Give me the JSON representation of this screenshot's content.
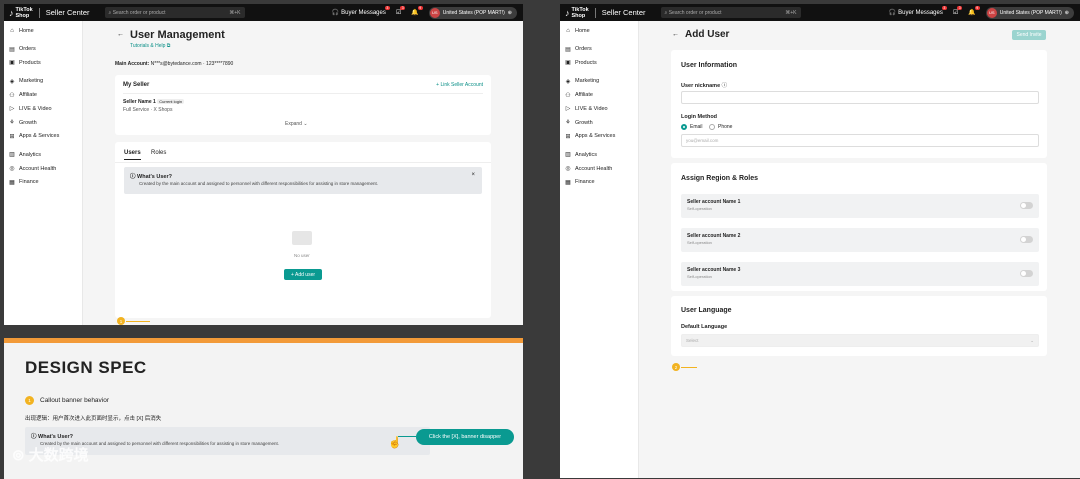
{
  "topbar": {
    "logo_line1": "TikTok",
    "logo_line2": "Shop",
    "seller_center": "Seller Center",
    "search_placeholder": "Search order or product",
    "search_shortcut": "⌘+K",
    "buyer_messages": "Buyer Messages",
    "badge1": "3",
    "badge2": "3",
    "badge3": "9",
    "avatar": "US",
    "region": "United States (POP MART!)"
  },
  "sidebar": {
    "items": [
      "Home",
      "Orders",
      "Products",
      "Marketing",
      "Affiliate",
      "LIVE & Video",
      "Growth",
      "Apps & Services",
      "Analytics",
      "Account Health",
      "Finance"
    ],
    "icons": [
      "home-icon",
      "orders-icon",
      "products-icon",
      "marketing-icon",
      "affiliate-icon",
      "live-video-icon",
      "growth-icon",
      "apps-icon",
      "analytics-icon",
      "account-health-icon",
      "finance-icon"
    ]
  },
  "user_mgmt": {
    "title": "User Management",
    "help_link": "Tutorials & Help",
    "main_account_label": "Main Account:",
    "main_account_value": "N***s@bytedance.com · 123****7890",
    "my_seller": "My Seller",
    "link_seller": "+ Link Seller Account",
    "seller_name": "Seller Name 1",
    "current_login": "Current login",
    "seller_sub": "Full Service · X Shops",
    "expand": "Expand",
    "tab_users": "Users",
    "tab_roles": "Roles",
    "callout_title": "What's User?",
    "callout_body": "Created by the main account and assigned to personnel with different responsibilities for assisting in store management.",
    "no_user": "No user",
    "add_user": "+ Add user",
    "marker": "1"
  },
  "add_user": {
    "title": "Add User",
    "send_invite": "Send Invite",
    "user_info": "User Information",
    "nickname_label": "User nickname",
    "login_method": "Login Method",
    "email_option": "Email",
    "phone_option": "Phone",
    "email_placeholder": "you@email.com",
    "assign_title": "Assign Region & Roles",
    "accounts": [
      {
        "name": "Seller account Name 1",
        "sub": "Self-operation"
      },
      {
        "name": "Seller account Name 2",
        "sub": "Self-operation"
      },
      {
        "name": "Seller account Name 3",
        "sub": "Self-operation"
      }
    ],
    "lang_title": "User Language",
    "default_lang": "Default Language",
    "select_placeholder": "Select",
    "marker": "2"
  },
  "design_spec": {
    "title": "DESIGN SPEC",
    "step": "1",
    "behavior": "Callout banner behavior",
    "rule": "出现逻辑：用户首次进入此页面时显示，点击 [X] 后消失",
    "callout_title": "What's User?",
    "callout_body": "Created by the main account and assigned to personnel with different responsibilities for assisting in store management.",
    "tooltip": "Click the [X], banner disapper",
    "watermark": "大数跨境"
  },
  "colors": {
    "accent": "#0a9a91",
    "marker": "#f2b321",
    "spec_bar": "#f29a38"
  }
}
